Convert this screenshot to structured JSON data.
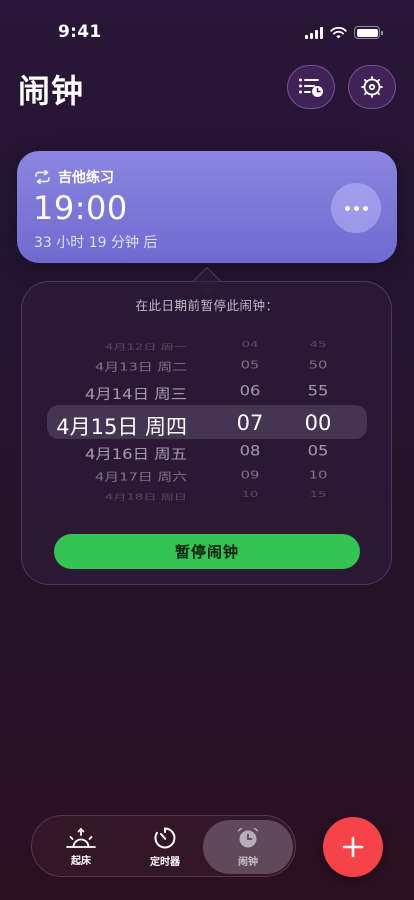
{
  "status_bar": {
    "time": "9:41"
  },
  "header": {
    "title": "闹钟"
  },
  "alarm": {
    "label": "吉他练习",
    "time": "19:00",
    "remaining": "33 小时 19 分钟 后"
  },
  "popover": {
    "title": "在此日期前暂停此闹钟：",
    "rows": [
      {
        "date": "4月12日 周一",
        "hour": "04",
        "minute": "45"
      },
      {
        "date": "4月13日 周二",
        "hour": "05",
        "minute": "50"
      },
      {
        "date": "4月14日 周三",
        "hour": "06",
        "minute": "55"
      },
      {
        "date": "4月15日 周四",
        "hour": "07",
        "minute": "00"
      },
      {
        "date": "4月16日 周五",
        "hour": "08",
        "minute": "05"
      },
      {
        "date": "4月17日 周六",
        "hour": "09",
        "minute": "10"
      },
      {
        "date": "4月18日 周日",
        "hour": "10",
        "minute": "15"
      }
    ],
    "button_label": "暂停闹钟"
  },
  "tabbar": {
    "tabs": [
      {
        "label": "起床"
      },
      {
        "label": "定时器"
      },
      {
        "label": "闹钟"
      }
    ]
  },
  "colors": {
    "card": "#7c78d8",
    "pause": "#33c453",
    "add": "#f6434a"
  }
}
